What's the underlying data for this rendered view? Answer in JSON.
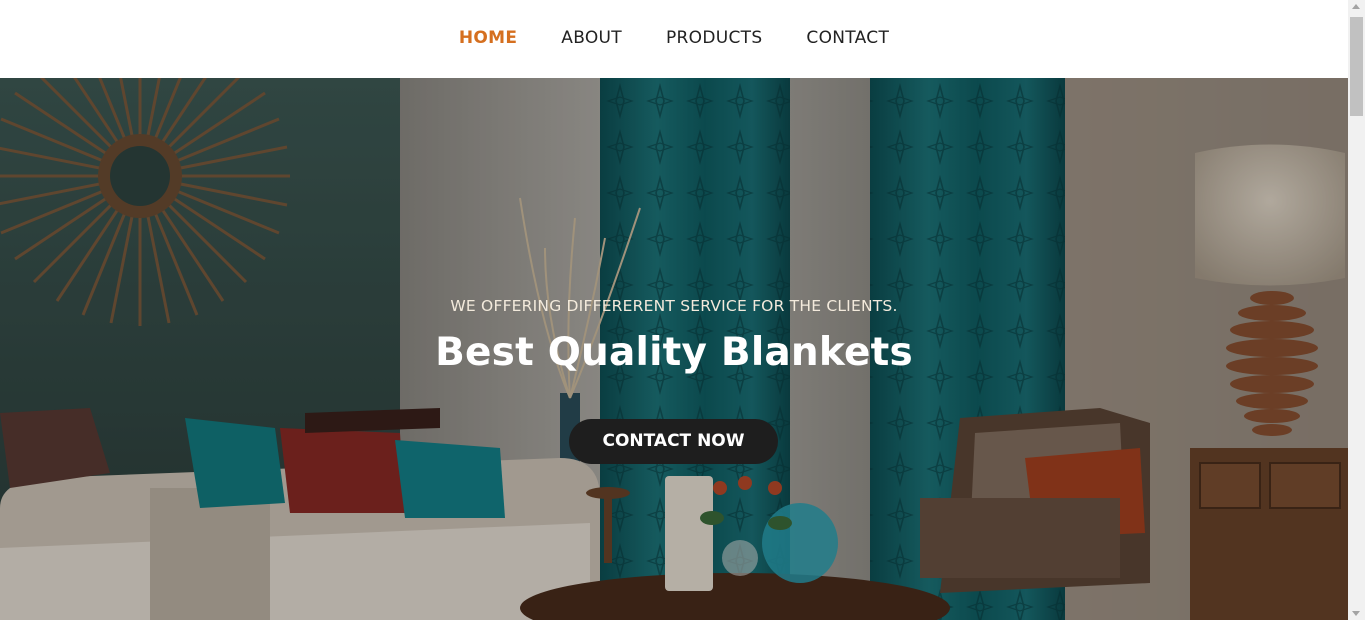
{
  "nav": {
    "items": [
      {
        "label": "HOME",
        "active": true
      },
      {
        "label": "ABOUT",
        "active": false
      },
      {
        "label": "PRODUCTS",
        "active": false
      },
      {
        "label": "CONTACT",
        "active": false
      }
    ],
    "active_color": "#d56f1f"
  },
  "hero": {
    "kicker": "WE OFFERING DIFFERERENT SERVICE FOR THE CLIENTS.",
    "title": "Best Quality Blankets",
    "button_label": "CONTACT NOW",
    "background_image": "living-room-photo"
  },
  "icons": {
    "scroll_up": "scroll-up-arrow-icon",
    "scroll_down": "scroll-down-arrow-icon"
  }
}
